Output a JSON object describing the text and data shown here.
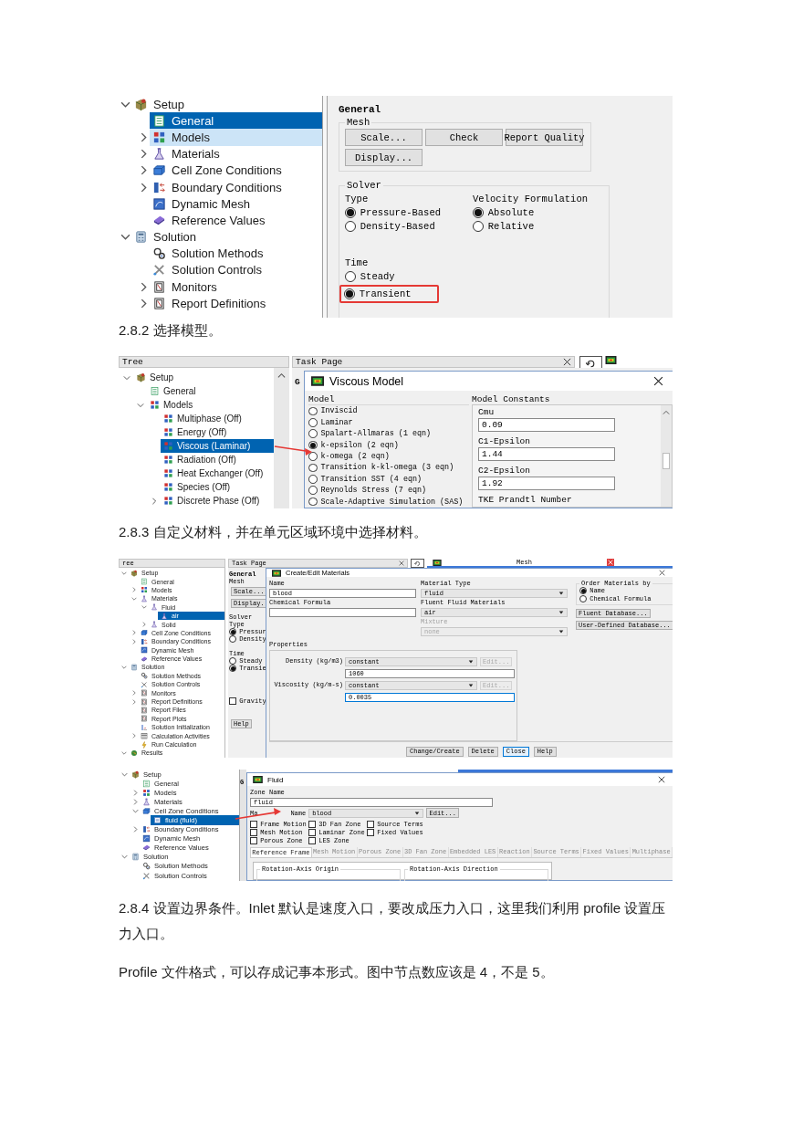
{
  "blocks": [
    {
      "kind": "general_screenshot",
      "tree": [
        {
          "label": "Setup",
          "kind": "setup",
          "expanded": true,
          "selected": false,
          "hovered": false,
          "children": [
            {
              "label": "General",
              "kind": "page",
              "selected": true,
              "hovered": false
            },
            {
              "label": "Models",
              "kind": "models",
              "expanded": false,
              "selected": false,
              "hovered": true
            },
            {
              "label": "Materials",
              "kind": "materials",
              "expanded": false,
              "selected": false,
              "hovered": false
            },
            {
              "label": "Cell Zone Conditions",
              "kind": "cellzone",
              "expanded": false,
              "selected": false,
              "hovered": false
            },
            {
              "label": "Boundary Conditions",
              "kind": "boundary",
              "expanded": false,
              "selected": false,
              "hovered": false
            },
            {
              "label": "Dynamic Mesh",
              "kind": "dynamic",
              "selected": false,
              "hovered": false
            },
            {
              "label": "Reference Values",
              "kind": "reference",
              "selected": false,
              "hovered": false
            }
          ]
        },
        {
          "label": "Solution",
          "kind": "solution",
          "expanded": true,
          "selected": false,
          "hovered": false,
          "children": [
            {
              "label": "Solution Methods",
              "kind": "methods",
              "selected": false,
              "hovered": false
            },
            {
              "label": "Solution Controls",
              "kind": "controls",
              "selected": false,
              "hovered": false
            },
            {
              "label": "Monitors",
              "kind": "report",
              "expanded": false,
              "selected": false,
              "hovered": false
            },
            {
              "label": "Report Definitions",
              "kind": "report",
              "expanded": false,
              "selected": false,
              "hovered": false
            }
          ]
        }
      ],
      "panel": {
        "title": "General",
        "mesh": {
          "label": "Mesh",
          "buttons": [
            "Scale...",
            "Check",
            "Report Quality",
            "Display..."
          ]
        },
        "solver": {
          "label": "Solver",
          "type": {
            "label": "Type",
            "options": [
              {
                "label": "Pressure-Based",
                "selected": true,
                "highlighted": false
              },
              {
                "label": "Density-Based",
                "selected": false,
                "highlighted": false
              }
            ]
          },
          "velocity": {
            "label": "Velocity Formulation",
            "options": [
              {
                "label": "Absolute",
                "selected": true,
                "highlighted": false
              },
              {
                "label": "Relative",
                "selected": false,
                "highlighted": false
              }
            ]
          },
          "time": {
            "label": "Time",
            "options": [
              {
                "label": "Steady",
                "selected": false,
                "highlighted": false
              },
              {
                "label": "Transient",
                "selected": true,
                "highlighted": true
              }
            ]
          }
        }
      }
    },
    {
      "kind": "paragraph",
      "text": "2.8.2 选择模型。"
    },
    {
      "kind": "viscous_screenshot",
      "tree_header": "Tree",
      "task_header": "Task Page",
      "task_heading": "G",
      "tree": [
        {
          "label": "Setup",
          "kind": "setup",
          "expanded": true,
          "selected": false,
          "children": [
            {
              "label": "General",
              "kind": "page",
              "selected": false
            },
            {
              "label": "Models",
              "kind": "models",
              "expanded": true,
              "selected": false,
              "children": [
                {
                  "label": "Multiphase (Off)",
                  "kind": "models",
                  "selected": false
                },
                {
                  "label": "Energy (Off)",
                  "kind": "models",
                  "selected": false
                },
                {
                  "label": "Viscous (Laminar)",
                  "kind": "models",
                  "selected": true
                },
                {
                  "label": "Radiation (Off)",
                  "kind": "models",
                  "selected": false
                },
                {
                  "label": "Heat Exchanger (Off)",
                  "kind": "models",
                  "selected": false
                },
                {
                  "label": "Species (Off)",
                  "kind": "models",
                  "selected": false
                },
                {
                  "label": "Discrete Phase (Off)",
                  "kind": "models",
                  "expanded": false,
                  "selected": false
                }
              ]
            }
          ]
        }
      ],
      "dialog": {
        "title": "Viscous Model",
        "model_label": "Model",
        "models": [
          {
            "label": "Inviscid",
            "selected": false
          },
          {
            "label": "Laminar",
            "selected": false
          },
          {
            "label": "Spalart-Allmaras (1 eqn)",
            "selected": false
          },
          {
            "label": "k-epsilon (2 eqn)",
            "selected": true
          },
          {
            "label": "k-omega (2 eqn)",
            "selected": false
          },
          {
            "label": "Transition k-kl-omega (3 eqn)",
            "selected": false
          },
          {
            "label": "Transition SST (4 eqn)",
            "selected": false
          },
          {
            "label": "Reynolds Stress (7 eqn)",
            "selected": false
          },
          {
            "label": "Scale-Adaptive Simulation (SAS)",
            "selected": false
          }
        ],
        "constants_label": "Model Constants",
        "constants": [
          {
            "label": "Cmu",
            "value": "0.09"
          },
          {
            "label": "C1-Epsilon",
            "value": "1.44"
          },
          {
            "label": "C2-Epsilon",
            "value": "1.92"
          },
          {
            "label": "TKE Prandtl Number"
          }
        ]
      }
    },
    {
      "kind": "paragraph",
      "text": "2.8.3 自定义材料，并在单元区域环境中选择材料。"
    },
    {
      "kind": "materials_screenshot",
      "tree_header": "ree",
      "task_header": "Task Page",
      "graphics_title": "Mesh",
      "tree": [
        {
          "label": "Setup",
          "kind": "setup",
          "expanded": true,
          "selected": false,
          "children": [
            {
              "label": "General",
              "kind": "page",
              "selected": false
            },
            {
              "label": "Models",
              "kind": "models",
              "expanded": false,
              "selected": false
            },
            {
              "label": "Materials",
              "kind": "materials",
              "expanded": true,
              "selected": false,
              "children": [
                {
                  "label": "Fluid",
                  "kind": "materials",
                  "expanded": true,
                  "selected": false,
                  "children": [
                    {
                      "label": "air",
                      "kind": "materials",
                      "selected": true
                    }
                  ]
                },
                {
                  "label": "Solid",
                  "kind": "materials",
                  "expanded": false,
                  "selected": false
                }
              ]
            },
            {
              "label": "Cell Zone Conditions",
              "kind": "cellzone",
              "expanded": false,
              "selected": false
            },
            {
              "label": "Boundary Conditions",
              "kind": "boundary",
              "expanded": false,
              "selected": false
            },
            {
              "label": "Dynamic Mesh",
              "kind": "dynamic",
              "selected": false
            },
            {
              "label": "Reference Values",
              "kind": "reference",
              "selected": false
            }
          ]
        },
        {
          "label": "Solution",
          "kind": "solution",
          "expanded": true,
          "selected": false,
          "children": [
            {
              "label": "Solution Methods",
              "kind": "methods",
              "selected": false
            },
            {
              "label": "Solution Controls",
              "kind": "controls",
              "selected": false
            },
            {
              "label": "Monitors",
              "kind": "report",
              "expanded": false,
              "selected": false
            },
            {
              "label": "Report Definitions",
              "kind": "report",
              "expanded": false,
              "selected": false
            },
            {
              "label": "Report Files",
              "kind": "report",
              "selected": false
            },
            {
              "label": "Report Plots",
              "kind": "report",
              "selected": false
            },
            {
              "label": "Solution Initialization",
              "kind": "init",
              "selected": false
            },
            {
              "label": "Calculation Activities",
              "kind": "activities",
              "expanded": false,
              "selected": false
            },
            {
              "label": "Run Calculation",
              "kind": "run",
              "selected": false
            }
          ]
        },
        {
          "label": "Results",
          "kind": "results",
          "expanded": true,
          "selected": false
        }
      ],
      "task": {
        "title": "General",
        "mesh_label": "Mesh",
        "buttons": [
          "Scale...",
          "Display."
        ],
        "solver_label": "Solver",
        "type_label": "Type",
        "type_options": [
          {
            "label": "Pressur",
            "selected": true
          },
          {
            "label": "Density",
            "selected": false
          }
        ],
        "time_label": "Time",
        "time_options": [
          {
            "label": "Steady",
            "selected": false
          },
          {
            "label": "Transie",
            "selected": true
          }
        ],
        "gravity": {
          "label": "Gravity",
          "checked": false
        },
        "help": "Help"
      },
      "dialog": {
        "title": "Create/Edit Materials",
        "name_label": "Name",
        "name": "blood",
        "formula_label": "Chemical Formula",
        "material_type_label": "Material Type",
        "material_type": "fluid",
        "fluent_materials_label": "Fluent Fluid Materials",
        "fluent_material": "air",
        "mixture": {
          "label": "Mixture",
          "value": "none",
          "disabled": true
        },
        "order": {
          "label": "Order Materials by",
          "options": [
            {
              "label": "Name",
              "selected": true
            },
            {
              "label": "Chemical Formula",
              "selected": false
            }
          ]
        },
        "database_buttons": [
          "Fluent Database...",
          "User-Defined Database..."
        ],
        "properties_label": "Properties",
        "properties": [
          {
            "label": "Density (kg/m3)",
            "method": "constant",
            "edit": {
              "label": "Edit...",
              "disabled": true
            },
            "value": "1060",
            "focused": false
          },
          {
            "label": "Viscosity (kg/m-s)",
            "method": "constant",
            "edit": {
              "label": "Edit...",
              "disabled": true
            },
            "value": "0.0035",
            "focused": true
          }
        ],
        "buttons": [
          {
            "label": "Change/Create",
            "focused": false
          },
          {
            "label": "Delete",
            "focused": false
          },
          {
            "label": "Close",
            "focused": true
          },
          {
            "label": "Help",
            "focused": false
          }
        ]
      }
    },
    {
      "kind": "fluid_screenshot",
      "task_heading": "G",
      "tree": [
        {
          "label": "Setup",
          "kind": "setup",
          "expanded": true,
          "selected": false,
          "children": [
            {
              "label": "General",
              "kind": "page",
              "selected": false
            },
            {
              "label": "Models",
              "kind": "models",
              "expanded": false,
              "selected": false
            },
            {
              "label": "Materials",
              "kind": "materials",
              "expanded": false,
              "selected": false
            },
            {
              "label": "Cell Zone Conditions",
              "kind": "cellzone",
              "expanded": true,
              "selected": false,
              "children": [
                {
                  "label": "fluid (fluid)",
                  "kind": "zone",
                  "selected": true
                }
              ]
            },
            {
              "label": "Boundary Conditions",
              "kind": "boundary",
              "expanded": false,
              "selected": false
            },
            {
              "label": "Dynamic Mesh",
              "kind": "dynamic",
              "selected": false
            },
            {
              "label": "Reference Values",
              "kind": "reference",
              "selected": false
            }
          ]
        },
        {
          "label": "Solution",
          "kind": "solution",
          "expanded": true,
          "selected": false,
          "children": [
            {
              "label": "Solution Methods",
              "kind": "methods",
              "selected": false
            },
            {
              "label": "Solution Controls",
              "kind": "controls",
              "selected": false
            }
          ]
        }
      ],
      "dialog": {
        "title": "Fluid",
        "zone_name_label": "Zone Name",
        "zone_name": "fluid",
        "material_label": [
          "Ma",
          "Name"
        ],
        "material": "blood",
        "edit": "Edit...",
        "options": [
          {
            "label": "Frame Motion",
            "checked": false
          },
          {
            "label": "3D Fan Zone",
            "checked": false
          },
          {
            "label": "Source Terms",
            "checked": false
          },
          {
            "label": "Mesh Motion",
            "checked": false
          },
          {
            "label": "Laminar Zone",
            "checked": false
          },
          {
            "label": "Fixed Values",
            "checked": false
          },
          {
            "label": "Porous Zone",
            "checked": false
          },
          {
            "label": "LES Zone",
            "checked": false
          }
        ],
        "tabs": [
          {
            "label": "Reference Frame",
            "selected": true
          },
          {
            "label": "Mesh Motion",
            "selected": false
          },
          {
            "label": "Porous Zone",
            "selected": false
          },
          {
            "label": "3D Fan Zone",
            "selected": false
          },
          {
            "label": "Embedded LES",
            "selected": false
          },
          {
            "label": "Reaction",
            "selected": false
          },
          {
            "label": "Source Terms",
            "selected": false
          },
          {
            "label": "Fixed Values",
            "selected": false
          },
          {
            "label": "Multiphase",
            "selected": false
          }
        ],
        "groups": [
          "Rotation-Axis Origin",
          "Rotation-Axis Direction"
        ]
      }
    },
    {
      "kind": "paragraph",
      "text": "2.8.4 设置边界条件。Inlet 默认是速度入口，要改成压力入口，这里我们利用 profile 设置压力入口。"
    },
    {
      "kind": "paragraph",
      "text": "Profile 文件格式，可以存成记事本形式。图中节点数应该是 4，不是 5。"
    }
  ]
}
